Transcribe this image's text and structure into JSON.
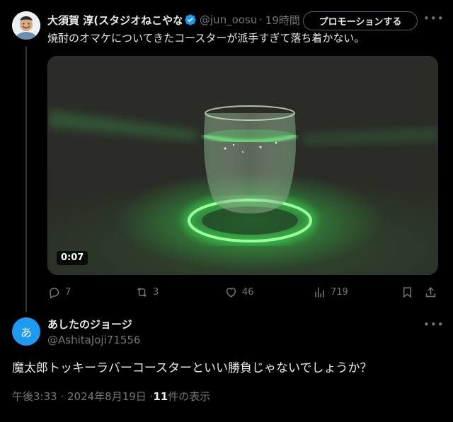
{
  "parent_tweet": {
    "display_name": "大須賀 淳(スタジオねこやな",
    "handle": "@jun_oosuga",
    "separator": "·",
    "time": "19時間",
    "promote_label": "プロモーションする",
    "text": "焼酎のオマケについてきたコースターが派手すぎて落ち着かない。",
    "video": {
      "duration": "0:07"
    },
    "stats": {
      "replies": "7",
      "reposts": "3",
      "likes": "46",
      "views": "719"
    }
  },
  "reply_tweet": {
    "avatar_letter": "あ",
    "display_name": "あしたのジョージ",
    "handle": "@AshitaJoji71556",
    "text": "魔太郎トッキーラバーコースターといい勝負じゃないでしょうか？",
    "timestamp": "午後3:33 · 2024年8月19日 · ",
    "view_count": "11",
    "view_suffix": " 件の表示"
  },
  "colors": {
    "background": "#000000",
    "text_primary": "#e7e9ea",
    "text_secondary": "#71767b",
    "verified_blue": "#1d9bf0",
    "reply_avatar": "#1d9bf0",
    "glow_green": "#3cff5a"
  },
  "icons": {
    "reply": "speech-bubble-icon",
    "repost": "repost-arrows-icon",
    "like": "heart-icon",
    "views": "bar-chart-icon",
    "bookmark": "bookmark-icon",
    "share": "upload-arrow-icon",
    "verified": "verified-badge-icon",
    "more": "more-dots-icon"
  }
}
